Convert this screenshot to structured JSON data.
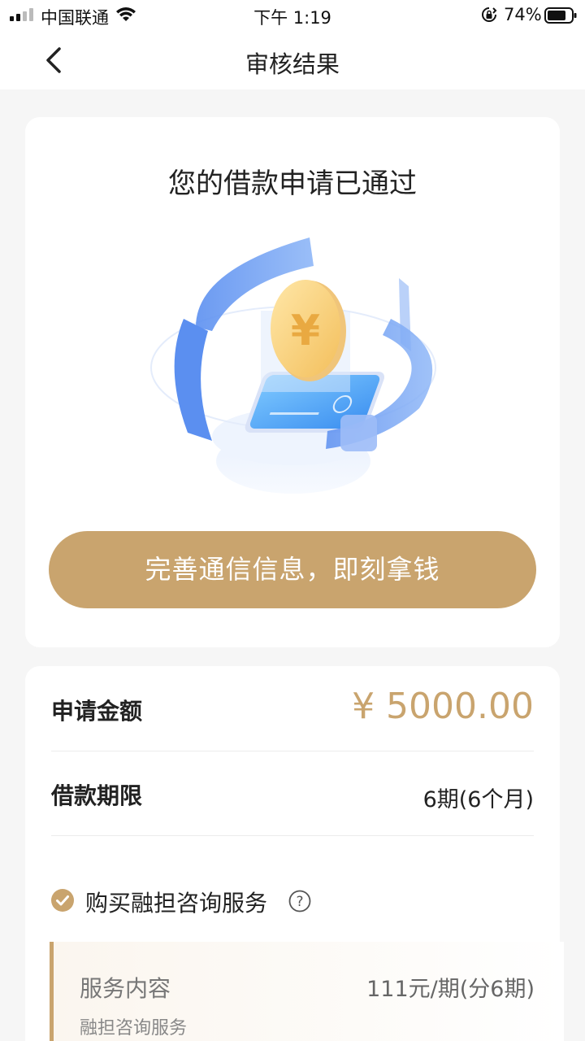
{
  "status_bar": {
    "carrier": "中国联通",
    "time": "下午 1:19",
    "battery": "74%"
  },
  "nav": {
    "title": "审核结果",
    "back_icon": "chevron-left-icon"
  },
  "result": {
    "title": "您的借款申请已通过",
    "cta_label": "完善通信信息，即刻拿钱"
  },
  "details": {
    "amount_label": "申请金额",
    "amount_value": "¥ 5000.00",
    "term_label": "借款期限",
    "term_value": "6期(6个月)",
    "service_checked": true,
    "service_label": "购买融担咨询服务",
    "service_box": {
      "title": "服务内容",
      "price": "111元/期(分6期)",
      "subtitle": "融担咨询服务"
    }
  },
  "colors": {
    "accent": "#c9a46e",
    "illustration_blue": "#6fa3f5"
  }
}
